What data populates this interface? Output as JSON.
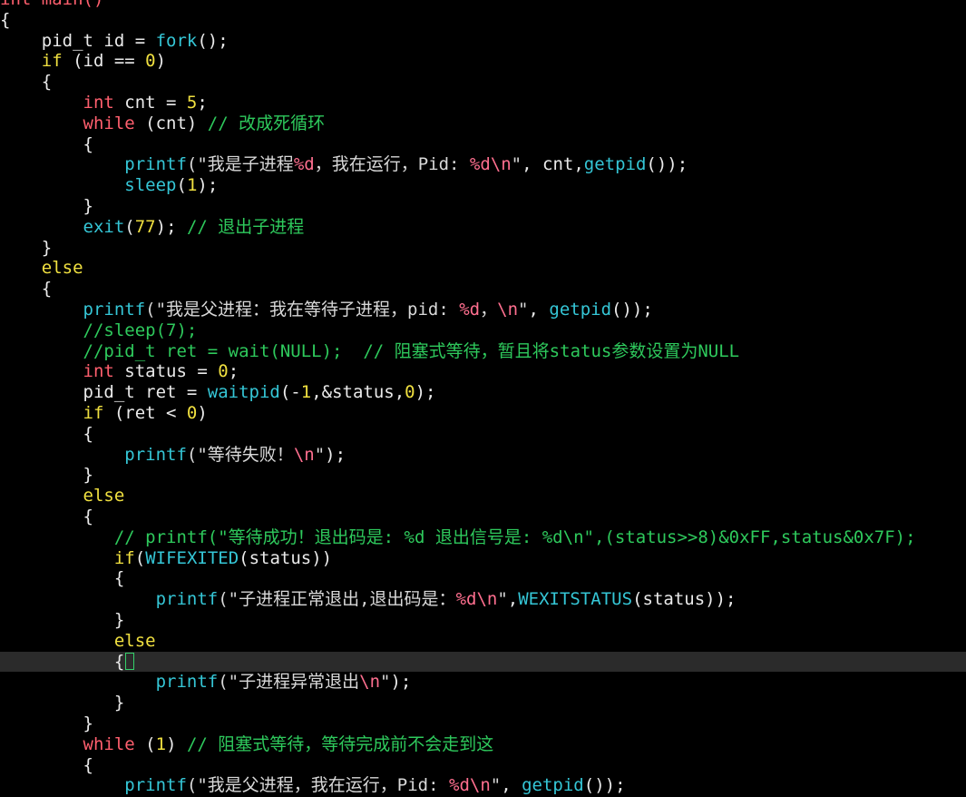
{
  "editor": {
    "colors": {
      "background": "#000000",
      "current_line": "#2b2b2b",
      "keyword": "#f0e040",
      "type": "#ff5f6e",
      "function": "#35c6d6",
      "string": "#d8d8d8",
      "format_spec": "#ff6f8f",
      "number": "#f0e040",
      "comment": "#2ec95c",
      "cursor": "#34d06a"
    },
    "current_line_index": 32,
    "lines": [
      [
        [
          "int main()",
          "t-type"
        ]
      ],
      [
        [
          "{",
          "t-plain"
        ]
      ],
      [
        [
          "    pid_t id = ",
          "t-plain"
        ],
        [
          "fork",
          "t-fn"
        ],
        [
          "();",
          "t-plain"
        ]
      ],
      [
        [
          "    ",
          "t-plain"
        ],
        [
          "if",
          "t-kw"
        ],
        [
          " (id == ",
          "t-plain"
        ],
        [
          "0",
          "t-num"
        ],
        [
          ")",
          "t-plain"
        ]
      ],
      [
        [
          "    {",
          "t-plain"
        ]
      ],
      [
        [
          "        ",
          "t-plain"
        ],
        [
          "int",
          "t-type"
        ],
        [
          " cnt = ",
          "t-plain"
        ],
        [
          "5",
          "t-num"
        ],
        [
          ";",
          "t-plain"
        ]
      ],
      [
        [
          "        ",
          "t-plain"
        ],
        [
          "while",
          "t-type"
        ],
        [
          " (cnt) ",
          "t-plain"
        ],
        [
          "// 改成死循环",
          "t-cmt"
        ]
      ],
      [
        [
          "        {",
          "t-plain"
        ]
      ],
      [
        [
          "            ",
          "t-plain"
        ],
        [
          "printf",
          "t-fn"
        ],
        [
          "(\"我是子进程",
          "t-str"
        ],
        [
          "%d",
          "t-fmt"
        ],
        [
          "，我在运行，Pid: ",
          "t-str"
        ],
        [
          "%d\\n",
          "t-fmt"
        ],
        [
          "\"",
          "t-str"
        ],
        [
          ", cnt,",
          "t-plain"
        ],
        [
          "getpid",
          "t-fn"
        ],
        [
          "());",
          "t-plain"
        ]
      ],
      [
        [
          "            ",
          "t-plain"
        ],
        [
          "sleep",
          "t-fn"
        ],
        [
          "(",
          "t-plain"
        ],
        [
          "1",
          "t-num"
        ],
        [
          ");",
          "t-plain"
        ]
      ],
      [
        [
          "        }",
          "t-plain"
        ]
      ],
      [
        [
          "        ",
          "t-plain"
        ],
        [
          "exit",
          "t-fn"
        ],
        [
          "(",
          "t-plain"
        ],
        [
          "77",
          "t-num"
        ],
        [
          "); ",
          "t-plain"
        ],
        [
          "// 退出子进程",
          "t-cmt"
        ]
      ],
      [
        [
          "    }",
          "t-plain"
        ]
      ],
      [
        [
          "    ",
          "t-plain"
        ],
        [
          "else",
          "t-kw"
        ]
      ],
      [
        [
          "    {",
          "t-plain"
        ]
      ],
      [
        [
          "        ",
          "t-plain"
        ],
        [
          "printf",
          "t-fn"
        ],
        [
          "(\"我是父进程：我在等待子进程，pid: ",
          "t-str"
        ],
        [
          "%d",
          "t-fmt"
        ],
        [
          "，",
          "t-str"
        ],
        [
          "\\n",
          "t-fmt"
        ],
        [
          "\"",
          "t-str"
        ],
        [
          ", ",
          "t-plain"
        ],
        [
          "getpid",
          "t-fn"
        ],
        [
          "());",
          "t-plain"
        ]
      ],
      [
        [
          "        ",
          "t-plain"
        ],
        [
          "//sleep(7);",
          "t-cmt"
        ]
      ],
      [
        [
          "        ",
          "t-plain"
        ],
        [
          "//pid_t ret = wait(NULL);  // 阻塞式等待，暂且将status参数设置为NULL",
          "t-cmt"
        ]
      ],
      [
        [
          "        ",
          "t-plain"
        ],
        [
          "int",
          "t-type"
        ],
        [
          " status = ",
          "t-plain"
        ],
        [
          "0",
          "t-num"
        ],
        [
          ";",
          "t-plain"
        ]
      ],
      [
        [
          "        pid_t ret = ",
          "t-plain"
        ],
        [
          "waitpid",
          "t-fn"
        ],
        [
          "(-",
          "t-plain"
        ],
        [
          "1",
          "t-num"
        ],
        [
          ",&status,",
          "t-plain"
        ],
        [
          "0",
          "t-num"
        ],
        [
          ");",
          "t-plain"
        ]
      ],
      [
        [
          "        ",
          "t-plain"
        ],
        [
          "if",
          "t-kw"
        ],
        [
          " (ret < ",
          "t-plain"
        ],
        [
          "0",
          "t-num"
        ],
        [
          ")",
          "t-plain"
        ]
      ],
      [
        [
          "        {",
          "t-plain"
        ]
      ],
      [
        [
          "            ",
          "t-plain"
        ],
        [
          "printf",
          "t-fn"
        ],
        [
          "(\"等待失败！",
          "t-str"
        ],
        [
          "\\n",
          "t-fmt"
        ],
        [
          "\"",
          "t-str"
        ],
        [
          ");",
          "t-plain"
        ]
      ],
      [
        [
          "        }",
          "t-plain"
        ]
      ],
      [
        [
          "        ",
          "t-plain"
        ],
        [
          "else",
          "t-kw"
        ]
      ],
      [
        [
          "        {",
          "t-plain"
        ]
      ],
      [
        [
          "           ",
          "t-plain"
        ],
        [
          "// printf(\"等待成功！退出码是: %d 退出信号是: %d\\n\",(status>>8)&0xFF,status&0x7F);",
          "t-cmt"
        ]
      ],
      [
        [
          "           ",
          "t-plain"
        ],
        [
          "if",
          "t-kw"
        ],
        [
          "(",
          "t-plain"
        ],
        [
          "WIFEXITED",
          "t-fn"
        ],
        [
          "(status))",
          "t-plain"
        ]
      ],
      [
        [
          "           {",
          "t-plain"
        ]
      ],
      [
        [
          "               ",
          "t-plain"
        ],
        [
          "printf",
          "t-fn"
        ],
        [
          "(\"子进程正常退出,退出码是：",
          "t-str"
        ],
        [
          "%d\\n",
          "t-fmt"
        ],
        [
          "\"",
          "t-str"
        ],
        [
          ",",
          "t-plain"
        ],
        [
          "WEXITSTATUS",
          "t-fn"
        ],
        [
          "(status));",
          "t-plain"
        ]
      ],
      [
        [
          "           }",
          "t-plain"
        ]
      ],
      [
        [
          "           ",
          "t-plain"
        ],
        [
          "else",
          "t-kw"
        ]
      ],
      [
        [
          "           {",
          "t-plain"
        ]
      ],
      [
        [
          "               ",
          "t-plain"
        ],
        [
          "printf",
          "t-fn"
        ],
        [
          "(\"子进程异常退出",
          "t-str"
        ],
        [
          "\\n",
          "t-fmt"
        ],
        [
          "\"",
          "t-str"
        ],
        [
          ");",
          "t-plain"
        ]
      ],
      [
        [
          "           }",
          "t-plain"
        ]
      ],
      [
        [
          "        }",
          "t-plain"
        ]
      ],
      [
        [
          "        ",
          "t-plain"
        ],
        [
          "while",
          "t-type"
        ],
        [
          " (",
          "t-plain"
        ],
        [
          "1",
          "t-num"
        ],
        [
          ") ",
          "t-plain"
        ],
        [
          "// 阻塞式等待，等待完成前不会走到这",
          "t-cmt"
        ]
      ],
      [
        [
          "        {",
          "t-plain"
        ]
      ],
      [
        [
          "            ",
          "t-plain"
        ],
        [
          "printf",
          "t-fn"
        ],
        [
          "(\"我是父进程，我在运行，Pid: ",
          "t-str"
        ],
        [
          "%d\\n",
          "t-fmt"
        ],
        [
          "\"",
          "t-str"
        ],
        [
          ", ",
          "t-plain"
        ],
        [
          "getpid",
          "t-fn"
        ],
        [
          "());",
          "t-plain"
        ]
      ]
    ]
  }
}
